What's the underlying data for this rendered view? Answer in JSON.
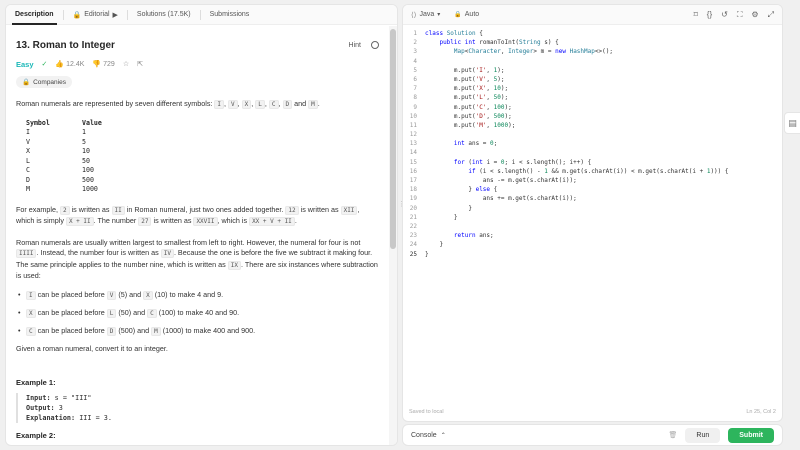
{
  "tabs": {
    "description": "Description",
    "editorial": "Editorial",
    "solutions": "Solutions (17.5K)",
    "submissions": "Submissions"
  },
  "problem": {
    "title": "13. Roman to Integer",
    "hint": "Hint",
    "difficulty": "Easy",
    "likes": "12.4K",
    "dislikes": "729",
    "companies": "Companies"
  },
  "description": {
    "intro_a": "Roman numerals are represented by seven different symbols: ",
    "intro_b": " and ",
    "intro_syms": [
      "I",
      "V",
      "X",
      "L",
      "C",
      "D"
    ],
    "intro_last": "M",
    "table_header": [
      "Symbol",
      "Value"
    ],
    "table_rows": [
      [
        "I",
        "1"
      ],
      [
        "V",
        "5"
      ],
      [
        "X",
        "10"
      ],
      [
        "L",
        "50"
      ],
      [
        "C",
        "100"
      ],
      [
        "D",
        "500"
      ],
      [
        "M",
        "1000"
      ]
    ],
    "p2_a": "For example, ",
    "p2_c1": "2",
    "p2_b": " is written as ",
    "p2_c2": "II",
    "p2_c": " in Roman numeral, just two ones added together. ",
    "p2_c3": "12",
    "p2_d": " is written as ",
    "p2_c4": "XII",
    "p2_e": ", which is simply ",
    "p2_c5": "X + II",
    "p2_f": ". The number ",
    "p2_c6": "27",
    "p2_g": " is written as ",
    "p2_c7": "XXVII",
    "p2_h": ", which is ",
    "p2_c8": "XX + V + II",
    "p2_i": ".",
    "p3_a": "Roman numerals are usually written largest to smallest from left to right. However, the numeral for four is not ",
    "p3_c1": "IIII",
    "p3_b": ". Instead, the number four is written as ",
    "p3_c2": "IV",
    "p3_c": ". Because the one is before the five we subtract it making four. The same principle applies to the number nine, which is written as ",
    "p3_c3": "IX",
    "p3_d": ". There are six instances where subtraction is used:",
    "bullets": [
      {
        "c0": "I",
        "t0": " can be placed before ",
        "c1": "V",
        "t1": " (5) and ",
        "c2": "X",
        "t2": " (10) to make 4 and 9."
      },
      {
        "c0": "X",
        "t0": " can be placed before ",
        "c1": "L",
        "t1": " (50) and ",
        "c2": "C",
        "t2": " (100) to make 40 and 90."
      },
      {
        "c0": "C",
        "t0": " can be placed before ",
        "c1": "D",
        "t1": " (500) and ",
        "c2": "M",
        "t2": " (1000) to make 400 and 900."
      }
    ],
    "task": "Given a roman numeral, convert it to an integer.",
    "example1_title": "Example 1:",
    "example1_input_label": "Input:",
    "example1_input": " s = \"III\"",
    "example1_output_label": "Output:",
    "example1_output": " 3",
    "example1_expl_label": "Explanation:",
    "example1_expl": " III = 3.",
    "example2_title": "Example 2:"
  },
  "editor": {
    "language": "Java",
    "mode": "Auto",
    "saved": "Saved to local",
    "position": "Ln 25, Col 2",
    "current_line": 25,
    "lines": [
      "class Solution {",
      "    public int romanToInt(String s) {",
      "        Map<Character, Integer> m = new HashMap<>();",
      "",
      "        m.put('I', 1);",
      "        m.put('V', 5);",
      "        m.put('X', 10);",
      "        m.put('L', 50);",
      "        m.put('C', 100);",
      "        m.put('D', 500);",
      "        m.put('M', 1000);",
      "",
      "        int ans = 0;",
      "",
      "        for (int i = 0; i < s.length(); i++) {",
      "            if (i < s.length() - 1 && m.get(s.charAt(i)) < m.get(s.charAt(i + 1))) {",
      "                ans -= m.get(s.charAt(i));",
      "            } else {",
      "                ans += m.get(s.charAt(i));",
      "            }",
      "        }",
      "",
      "        return ans;",
      "    }",
      "}"
    ]
  },
  "console": {
    "label": "Console",
    "run": "Run",
    "submit": "Submit"
  },
  "colors": {
    "easy": "#1cb8b8",
    "submit": "#2db55d",
    "keyword": "#0000ff",
    "type": "#267f99",
    "number": "#098658",
    "string": "#a31515"
  }
}
